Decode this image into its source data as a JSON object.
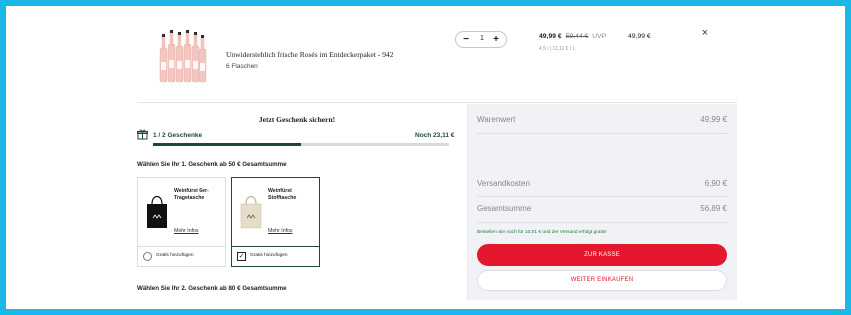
{
  "cart_item": {
    "title": "Unwiderstehlich frische Rosés im Entdeckerpaket - 942",
    "subtitle": "6 Flaschen",
    "quantity": "1",
    "minus": "−",
    "plus": "+",
    "price": "49,99 €",
    "old_price": "59,44 €",
    "uvp": "UVP",
    "unit_price": "4,5 l | 11,11 € / L",
    "line_total": "49,99 €",
    "remove": "×"
  },
  "gift": {
    "heading": "Jetzt Geschenk sichern!",
    "count": "1 / 2 Geschenke",
    "next": "Noch 23,11 €",
    "progress": 0.5,
    "choose_1": "Wählen Sie Ihr 1. Geschenk ab 50 € Gesamtsumme",
    "choose_2": "Wählen Sie Ihr 2. Geschenk ab 80 € Gesamtsumme",
    "options": [
      {
        "name": "Weinfürst 6er-Tragetasche",
        "more": "Mehr Infos",
        "add": "Gratis hinzufügen",
        "selected": false
      },
      {
        "name": "Weinfürst Stofftasche",
        "more": "Mehr Infos",
        "add": "Gratis hinzufügen",
        "selected": true
      }
    ]
  },
  "summary": {
    "warenwert_label": "Warenwert",
    "warenwert_value": "49,99 €",
    "versand_label": "Versandkosten",
    "versand_value": "6,90 €",
    "gesamt_label": "Gesamtsumme",
    "gesamt_value": "56,89 €",
    "ship_note": "Bestellen Sie noch für 10,01 € und der Versand erfolgt gratis!",
    "checkout": "ZUR KASSE",
    "continue": "WEITER EINKAUFEN"
  },
  "colors": {
    "frame": "#1ab8e6",
    "accent_green": "#1e4a34",
    "accent_red": "#e4172f"
  }
}
